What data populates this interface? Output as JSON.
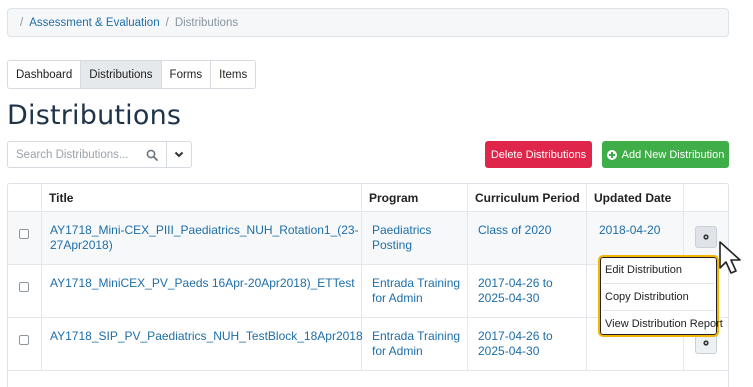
{
  "breadcrumb": {
    "separator": "/",
    "link": "Assessment & Evaluation",
    "current": "Distributions"
  },
  "tabs": [
    {
      "label": "Dashboard",
      "active": false
    },
    {
      "label": "Distributions",
      "active": true
    },
    {
      "label": "Forms",
      "active": false
    },
    {
      "label": "Items",
      "active": false
    }
  ],
  "page_title": "Distributions",
  "search": {
    "placeholder": "Search Distributions...",
    "value": "",
    "icon": "search-icon",
    "dropdown_icon": "chevron-down-icon"
  },
  "buttons": {
    "delete_label": "Delete Distributions",
    "add_label": "Add New Distribution",
    "delete_color": "#e0254a",
    "add_color": "#3fae49"
  },
  "table": {
    "headers": [
      "Title",
      "Program",
      "Curriculum Period",
      "Updated Date"
    ],
    "rows": [
      {
        "title_line1": "AY1718_Mini-CEX_PIII_Paediatrics_NUH_Rotation1_(23-",
        "title_line2": "27Apr2018)",
        "program_line1": "Paediatrics",
        "program_line2": "Posting",
        "period_line1": "Class of 2020",
        "period_line2": "",
        "updated": "2018-04-20"
      },
      {
        "title_line1": "AY1718_MiniCEX_PV_Paeds 16Apr-20Apr2018)_ETTest",
        "title_line2": "",
        "program_line1": "Entrada Training",
        "program_line2": "for Admin",
        "period_line1": "2017-04-26 to",
        "period_line2": "2025-04-30",
        "updated": ""
      },
      {
        "title_line1": "AY1718_SIP_PV_Paediatrics_NUH_TestBlock_18Apr2018",
        "title_line2": "",
        "program_line1": "Entrada Training",
        "program_line2": "for Admin",
        "period_line1": "2017-04-26 to",
        "period_line2": "2025-04-30",
        "updated": ""
      }
    ]
  },
  "row_menu": {
    "items": [
      "Edit Distribution",
      "Copy Distribution",
      "View Distribution Report"
    ],
    "highlight_color": "#f2b705"
  },
  "colors": {
    "link": "#1e6ea7",
    "title": "#1f3449"
  }
}
